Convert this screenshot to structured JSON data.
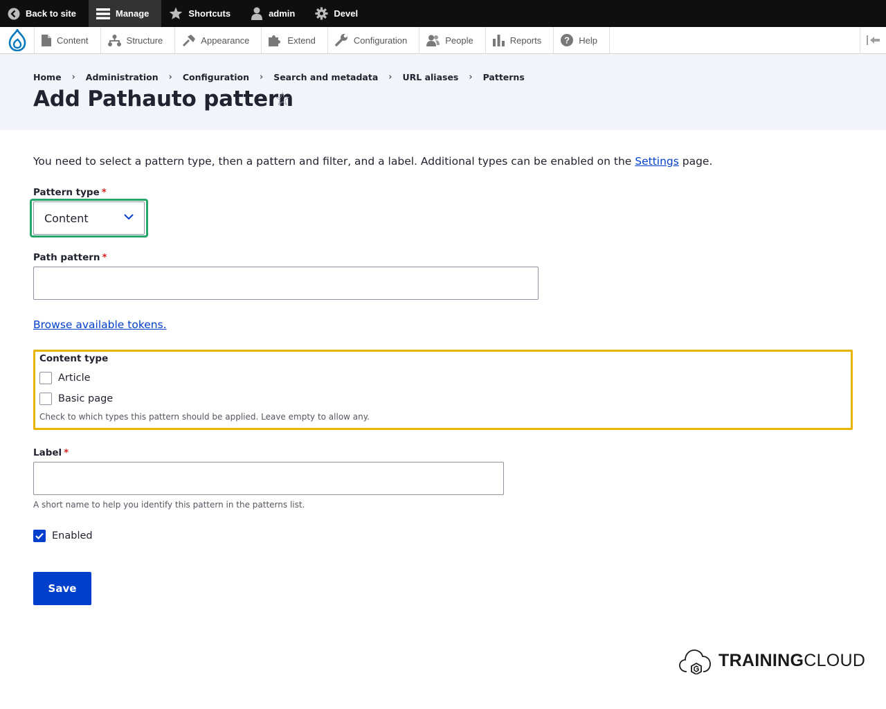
{
  "toolbar": {
    "back_to_site": "Back to site",
    "manage": "Manage",
    "shortcuts": "Shortcuts",
    "user": "admin",
    "devel": "Devel"
  },
  "tray": {
    "items": [
      "Content",
      "Structure",
      "Appearance",
      "Extend",
      "Configuration",
      "People",
      "Reports",
      "Help"
    ]
  },
  "breadcrumb": [
    "Home",
    "Administration",
    "Configuration",
    "Search and metadata",
    "URL aliases",
    "Patterns"
  ],
  "page": {
    "title": "Add Pathauto pattern",
    "intro_before": "You need to select a pattern type, then a pattern and filter, and a label. Additional types can be enabled on the ",
    "intro_link": "Settings",
    "intro_after": " page."
  },
  "form": {
    "pattern_type": {
      "label": "Pattern type",
      "value": "Content",
      "required_mark": "*"
    },
    "path_pattern": {
      "label": "Path pattern",
      "value": "",
      "required_mark": "*"
    },
    "tokens_link": "Browse available tokens.",
    "content_type": {
      "legend": "Content type",
      "options": [
        {
          "label": "Article",
          "checked": false
        },
        {
          "label": "Basic page",
          "checked": false
        }
      ],
      "description": "Check to which types this pattern should be applied. Leave empty to allow any."
    },
    "label_field": {
      "label": "Label",
      "value": "",
      "required_mark": "*",
      "description": "A short name to help you identify this pattern in the patterns list."
    },
    "enabled": {
      "label": "Enabled",
      "checked": true
    },
    "save": "Save"
  },
  "brand": {
    "bold": "TRAINING",
    "regular": "CLOUD"
  },
  "colors": {
    "accent_blue": "#003ecc",
    "focus_green": "#26a769",
    "highlight_yellow": "#e9b400",
    "required_red": "#d72222",
    "toolbar_black": "#0f0f0f"
  }
}
